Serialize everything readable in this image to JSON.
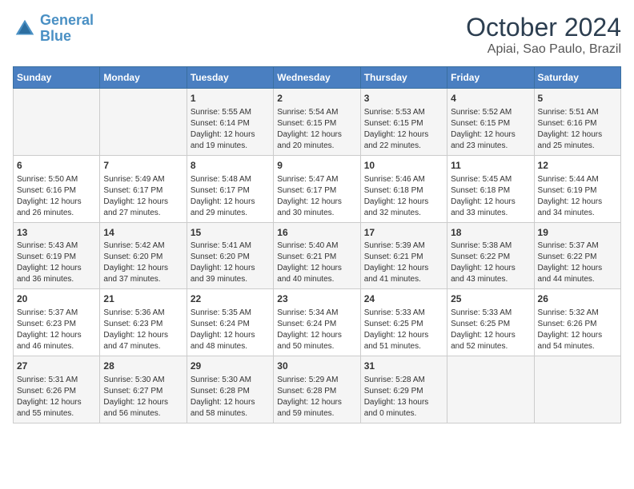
{
  "header": {
    "logo_line1": "General",
    "logo_line2": "Blue",
    "month": "October 2024",
    "location": "Apiai, Sao Paulo, Brazil"
  },
  "days_of_week": [
    "Sunday",
    "Monday",
    "Tuesday",
    "Wednesday",
    "Thursday",
    "Friday",
    "Saturday"
  ],
  "weeks": [
    [
      {
        "day": "",
        "content": ""
      },
      {
        "day": "",
        "content": ""
      },
      {
        "day": "1",
        "content": "Sunrise: 5:55 AM\nSunset: 6:14 PM\nDaylight: 12 hours and 19 minutes."
      },
      {
        "day": "2",
        "content": "Sunrise: 5:54 AM\nSunset: 6:15 PM\nDaylight: 12 hours and 20 minutes."
      },
      {
        "day": "3",
        "content": "Sunrise: 5:53 AM\nSunset: 6:15 PM\nDaylight: 12 hours and 22 minutes."
      },
      {
        "day": "4",
        "content": "Sunrise: 5:52 AM\nSunset: 6:15 PM\nDaylight: 12 hours and 23 minutes."
      },
      {
        "day": "5",
        "content": "Sunrise: 5:51 AM\nSunset: 6:16 PM\nDaylight: 12 hours and 25 minutes."
      }
    ],
    [
      {
        "day": "6",
        "content": "Sunrise: 5:50 AM\nSunset: 6:16 PM\nDaylight: 12 hours and 26 minutes."
      },
      {
        "day": "7",
        "content": "Sunrise: 5:49 AM\nSunset: 6:17 PM\nDaylight: 12 hours and 27 minutes."
      },
      {
        "day": "8",
        "content": "Sunrise: 5:48 AM\nSunset: 6:17 PM\nDaylight: 12 hours and 29 minutes."
      },
      {
        "day": "9",
        "content": "Sunrise: 5:47 AM\nSunset: 6:17 PM\nDaylight: 12 hours and 30 minutes."
      },
      {
        "day": "10",
        "content": "Sunrise: 5:46 AM\nSunset: 6:18 PM\nDaylight: 12 hours and 32 minutes."
      },
      {
        "day": "11",
        "content": "Sunrise: 5:45 AM\nSunset: 6:18 PM\nDaylight: 12 hours and 33 minutes."
      },
      {
        "day": "12",
        "content": "Sunrise: 5:44 AM\nSunset: 6:19 PM\nDaylight: 12 hours and 34 minutes."
      }
    ],
    [
      {
        "day": "13",
        "content": "Sunrise: 5:43 AM\nSunset: 6:19 PM\nDaylight: 12 hours and 36 minutes."
      },
      {
        "day": "14",
        "content": "Sunrise: 5:42 AM\nSunset: 6:20 PM\nDaylight: 12 hours and 37 minutes."
      },
      {
        "day": "15",
        "content": "Sunrise: 5:41 AM\nSunset: 6:20 PM\nDaylight: 12 hours and 39 minutes."
      },
      {
        "day": "16",
        "content": "Sunrise: 5:40 AM\nSunset: 6:21 PM\nDaylight: 12 hours and 40 minutes."
      },
      {
        "day": "17",
        "content": "Sunrise: 5:39 AM\nSunset: 6:21 PM\nDaylight: 12 hours and 41 minutes."
      },
      {
        "day": "18",
        "content": "Sunrise: 5:38 AM\nSunset: 6:22 PM\nDaylight: 12 hours and 43 minutes."
      },
      {
        "day": "19",
        "content": "Sunrise: 5:37 AM\nSunset: 6:22 PM\nDaylight: 12 hours and 44 minutes."
      }
    ],
    [
      {
        "day": "20",
        "content": "Sunrise: 5:37 AM\nSunset: 6:23 PM\nDaylight: 12 hours and 46 minutes."
      },
      {
        "day": "21",
        "content": "Sunrise: 5:36 AM\nSunset: 6:23 PM\nDaylight: 12 hours and 47 minutes."
      },
      {
        "day": "22",
        "content": "Sunrise: 5:35 AM\nSunset: 6:24 PM\nDaylight: 12 hours and 48 minutes."
      },
      {
        "day": "23",
        "content": "Sunrise: 5:34 AM\nSunset: 6:24 PM\nDaylight: 12 hours and 50 minutes."
      },
      {
        "day": "24",
        "content": "Sunrise: 5:33 AM\nSunset: 6:25 PM\nDaylight: 12 hours and 51 minutes."
      },
      {
        "day": "25",
        "content": "Sunrise: 5:33 AM\nSunset: 6:25 PM\nDaylight: 12 hours and 52 minutes."
      },
      {
        "day": "26",
        "content": "Sunrise: 5:32 AM\nSunset: 6:26 PM\nDaylight: 12 hours and 54 minutes."
      }
    ],
    [
      {
        "day": "27",
        "content": "Sunrise: 5:31 AM\nSunset: 6:26 PM\nDaylight: 12 hours and 55 minutes."
      },
      {
        "day": "28",
        "content": "Sunrise: 5:30 AM\nSunset: 6:27 PM\nDaylight: 12 hours and 56 minutes."
      },
      {
        "day": "29",
        "content": "Sunrise: 5:30 AM\nSunset: 6:28 PM\nDaylight: 12 hours and 58 minutes."
      },
      {
        "day": "30",
        "content": "Sunrise: 5:29 AM\nSunset: 6:28 PM\nDaylight: 12 hours and 59 minutes."
      },
      {
        "day": "31",
        "content": "Sunrise: 5:28 AM\nSunset: 6:29 PM\nDaylight: 13 hours and 0 minutes."
      },
      {
        "day": "",
        "content": ""
      },
      {
        "day": "",
        "content": ""
      }
    ]
  ]
}
